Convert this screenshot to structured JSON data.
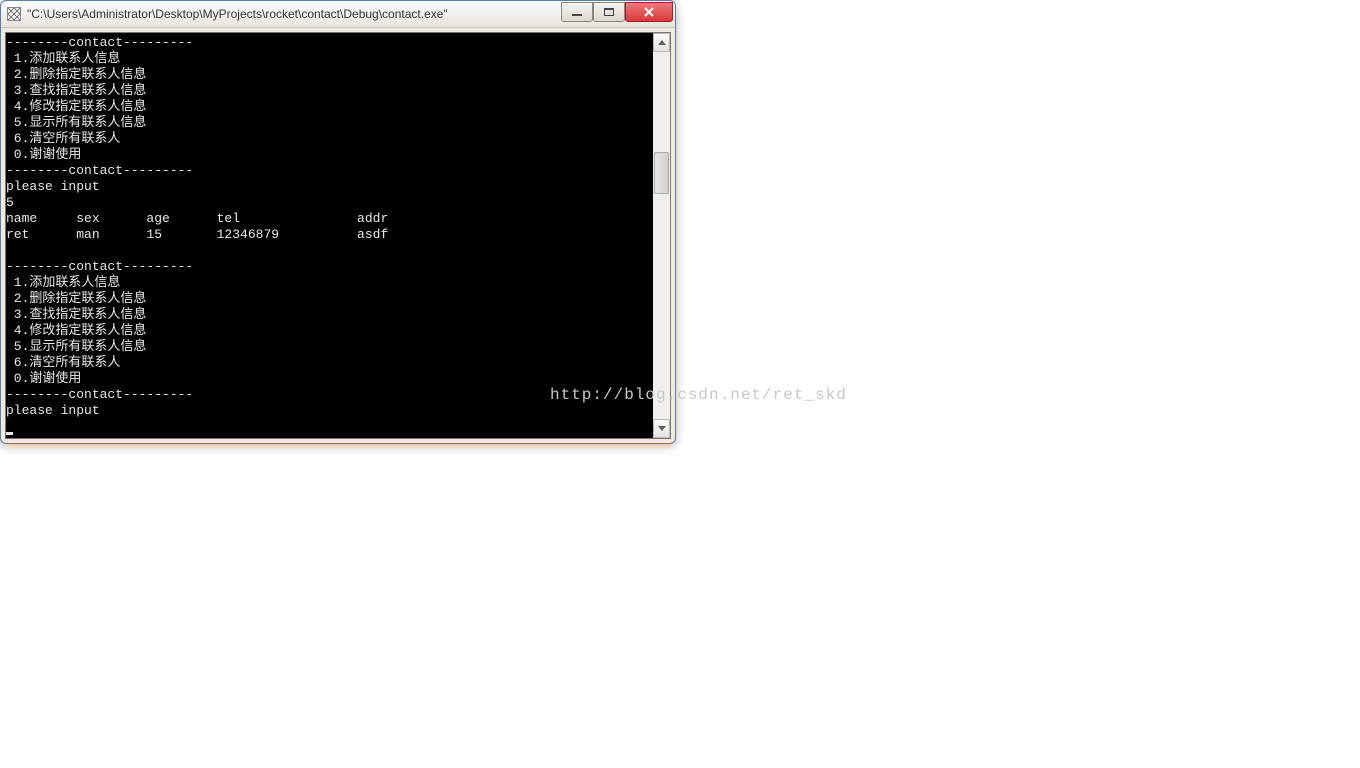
{
  "window": {
    "title": "\"C:\\Users\\Administrator\\Desktop\\MyProjects\\rocket\\contact\\Debug\\contact.exe\""
  },
  "menu": {
    "header": "--------contact---------",
    "items": [
      " 1.添加联系人信息",
      " 2.删除指定联系人信息",
      " 3.查找指定联系人信息",
      " 4.修改指定联系人信息",
      " 5.显示所有联系人信息",
      " 6.清空所有联系人",
      " 0.谢谢使用"
    ],
    "footer": "--------contact---------"
  },
  "prompt": "please input",
  "input_value": "5",
  "table": {
    "header": {
      "name": "name",
      "sex": "sex",
      "age": "age",
      "tel": "tel",
      "addr": "addr"
    },
    "rows": [
      {
        "name": "ret",
        "sex": "man",
        "age": "15",
        "tel": "12346879",
        "addr": "asdf"
      }
    ]
  },
  "watermark": "http://blog.csdn.net/ret_skd"
}
